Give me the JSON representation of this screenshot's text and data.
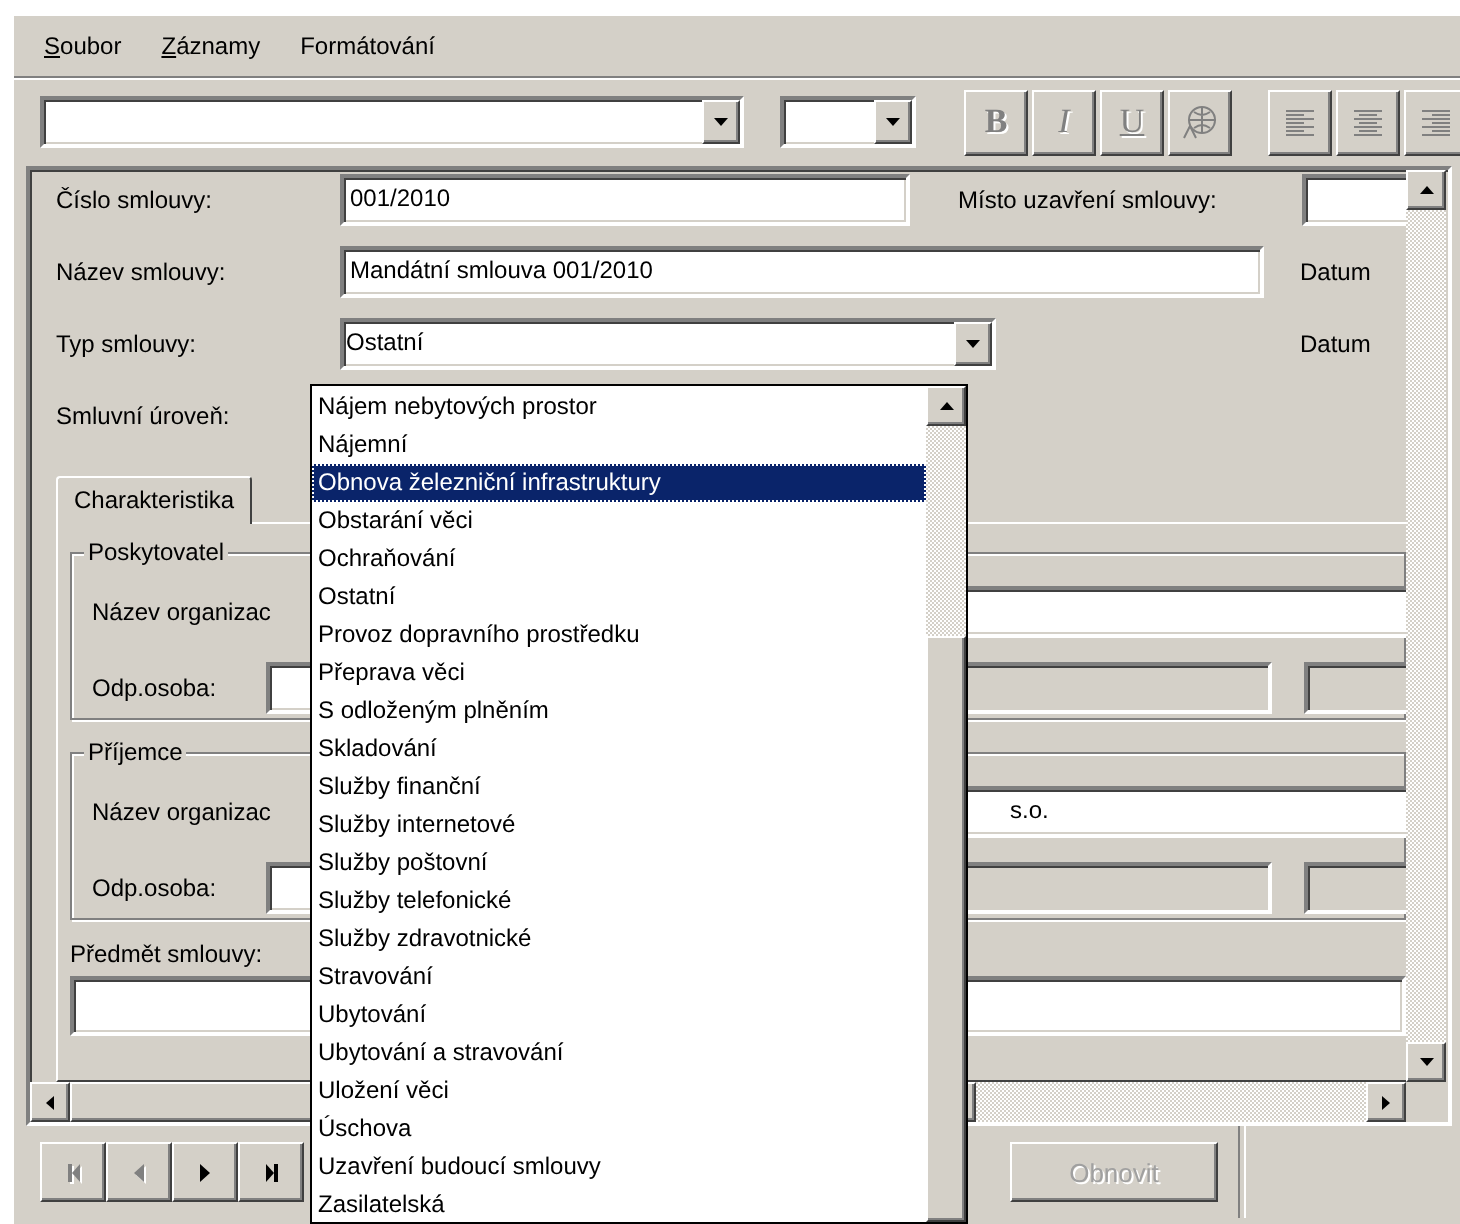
{
  "menu": [
    {
      "label": "Soubor",
      "underline_first": true
    },
    {
      "label": "Záznamy",
      "underline_first": true
    },
    {
      "label": "Formátování",
      "underline_first": false
    }
  ],
  "toolbar": {
    "format_buttons": [
      {
        "kind": "bold",
        "label": "B",
        "disabled": true
      },
      {
        "kind": "italic",
        "label": "I",
        "disabled": true
      },
      {
        "kind": "underline",
        "label": "U",
        "disabled": true
      },
      {
        "kind": "color",
        "disabled": true
      }
    ],
    "align_buttons": [
      {
        "kind": "left",
        "disabled": true
      },
      {
        "kind": "center",
        "disabled": true
      },
      {
        "kind": "right",
        "disabled": true
      }
    ]
  },
  "form": {
    "contract_number": {
      "label": "Číslo smlouvy:",
      "value": "001/2010"
    },
    "place_label": "Místo uzavření smlouvy:",
    "contract_name": {
      "label": "Název smlouvy:",
      "value": "Mandátní smlouva 001/2010"
    },
    "date_labels": [
      "Datum",
      "Datum"
    ],
    "contract_type": {
      "label": "Typ smlouvy:",
      "value": "Ostatní"
    },
    "level_label": "Smluvní úroveň:"
  },
  "tabs": [
    {
      "label": "Charakteristika",
      "selected": true
    }
  ],
  "groups": [
    {
      "title": "Poskytovatel",
      "org_label": "Název organizac",
      "contact_label": "Odp.osoba:"
    },
    {
      "title": "Příjemce",
      "org_label": "Název organizac",
      "org_value": "s.o.",
      "contact_label": "Odp.osoba:"
    }
  ],
  "subject_label": "Předmět smlouvy:",
  "nav_buttons": [
    {
      "kind": "first",
      "disabled": true
    },
    {
      "kind": "prev",
      "disabled": true
    },
    {
      "kind": "next",
      "disabled": false
    },
    {
      "kind": "last",
      "disabled": false
    }
  ],
  "refresh_button": {
    "label": "Obnovit",
    "disabled": true
  },
  "dropdown": [
    {
      "label": "Nájem nebytových prostor",
      "selected": false
    },
    {
      "label": "Nájemní",
      "selected": false
    },
    {
      "label": "Obnova železniční infrastruktury",
      "selected": true
    },
    {
      "label": "Obstarání věci",
      "selected": false
    },
    {
      "label": "Ochraňování",
      "selected": false
    },
    {
      "label": "Ostatní",
      "selected": false
    },
    {
      "label": "Provoz dopravního prostředku",
      "selected": false
    },
    {
      "label": "Přeprava věci",
      "selected": false
    },
    {
      "label": "S odloženým plněním",
      "selected": false
    },
    {
      "label": "Skladování",
      "selected": false
    },
    {
      "label": "Služby finanční",
      "selected": false
    },
    {
      "label": "Služby internetové",
      "selected": false
    },
    {
      "label": "Služby poštovní",
      "selected": false
    },
    {
      "label": "Služby telefonické",
      "selected": false
    },
    {
      "label": "Služby zdravotnické",
      "selected": false
    },
    {
      "label": "Stravování",
      "selected": false
    },
    {
      "label": "Ubytování",
      "selected": false
    },
    {
      "label": "Ubytování a stravování",
      "selected": false
    },
    {
      "label": "Uložení věci",
      "selected": false
    },
    {
      "label": "Úschova",
      "selected": false
    },
    {
      "label": "Uzavření budoucí smlouvy",
      "selected": false
    },
    {
      "label": "Zasilatelská",
      "selected": false
    }
  ]
}
